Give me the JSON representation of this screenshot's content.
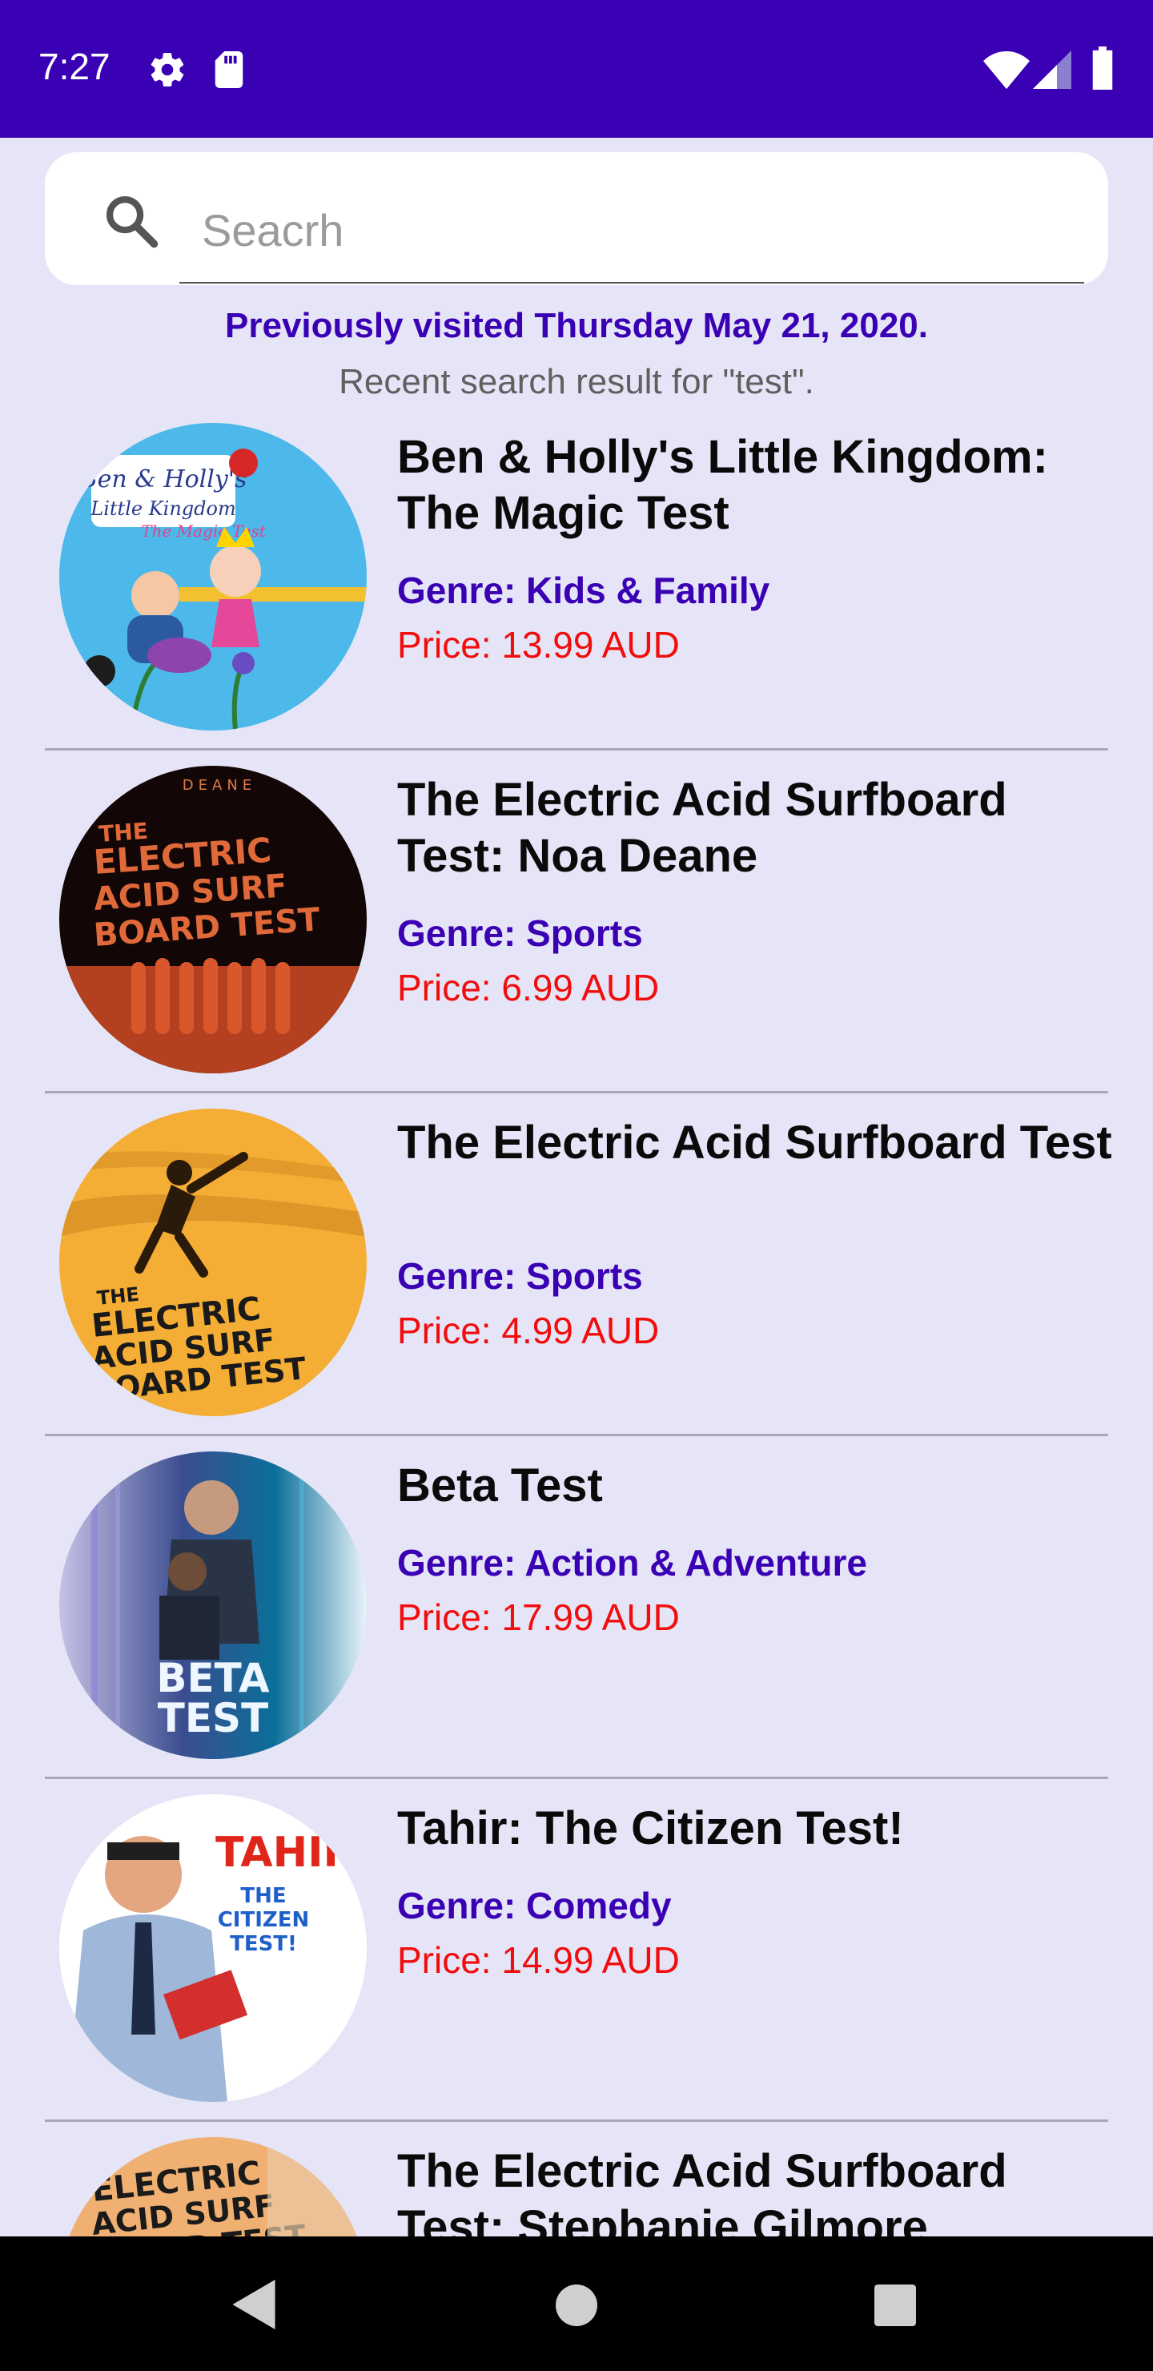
{
  "status_bar": {
    "time": "7:27",
    "icons": [
      "gear-icon",
      "sd-card-icon",
      "wifi-icon",
      "cell-signal-icon",
      "battery-icon"
    ]
  },
  "search": {
    "placeholder": "Seacrh",
    "value": ""
  },
  "header": {
    "visited": "Previously visited Thursday May 21, 2020.",
    "recent": "Recent search result for \"test\"."
  },
  "results": [
    {
      "title": "Ben & Holly's Little Kingdom: The Magic Test",
      "genre": "Genre: Kids & Family",
      "price": "Price: 13.99 AUD",
      "art_text": [
        "Ben & Holly's",
        "Little Kingdom",
        "The Magic Test"
      ]
    },
    {
      "title": "The Electric Acid Surfboard Test: Noa Deane",
      "genre": "Genre: Sports",
      "price": "Price: 6.99 AUD",
      "art_text": [
        "DEANE",
        "THE",
        "ELECTRIC",
        "ACID SURF",
        "BOARD TEST"
      ]
    },
    {
      "title": "The Electric Acid Surfboard Test",
      "genre": "Genre: Sports",
      "price": "Price: 4.99 AUD",
      "art_text": [
        "THE",
        "ELECTRIC",
        "ACID SURF",
        "BOARD TEST"
      ]
    },
    {
      "title": "Beta Test",
      "genre": "Genre: Action & Adventure",
      "price": "Price: 17.99 AUD",
      "art_text": [
        "BETA",
        "TEST"
      ]
    },
    {
      "title": "Tahir: The Citizen Test!",
      "genre": "Genre: Comedy",
      "price": "Price: 14.99 AUD",
      "art_text": [
        "TAHIR",
        "THE",
        "CITIZEN",
        "TEST!"
      ]
    },
    {
      "title": "The Electric Acid Surfboard Test: Stephanie Gilmore",
      "genre": "",
      "price": "",
      "art_text": [
        "ELECTRIC",
        "ACID SURF",
        "BOARD TEST"
      ]
    }
  ],
  "colors": {
    "status_bar": "#3a00b4",
    "background": "#e6e5f7",
    "genre": "#3a00b4",
    "price": "#f20d0d"
  }
}
